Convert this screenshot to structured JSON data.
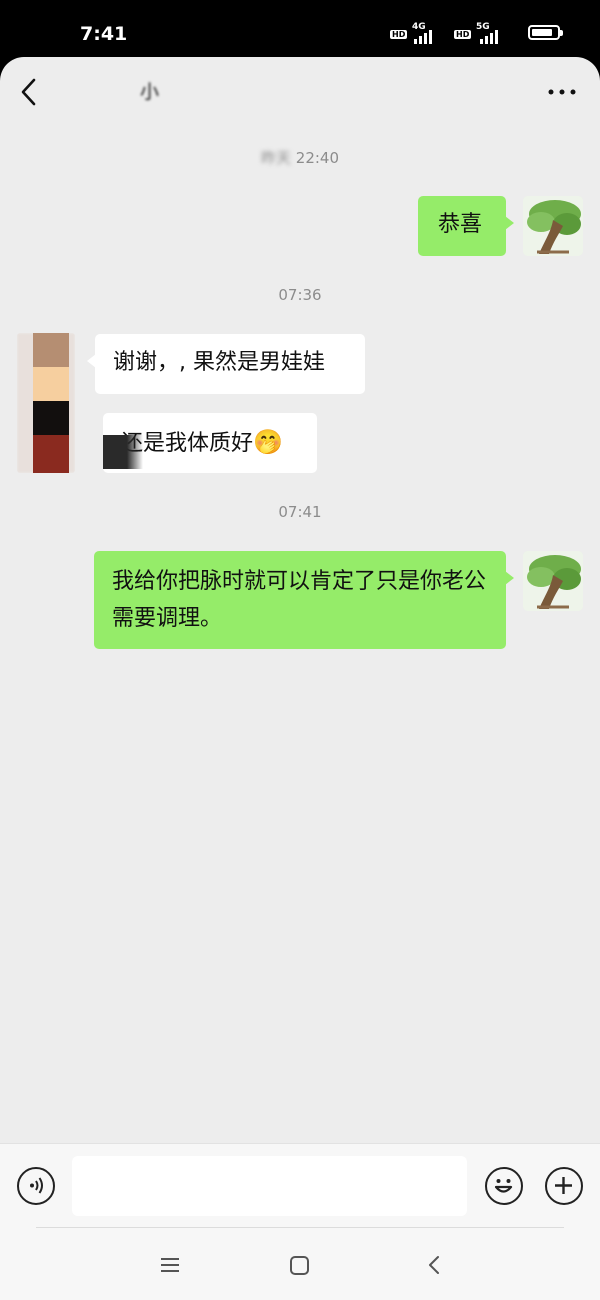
{
  "status_bar": {
    "time": "7:41",
    "network_1": "4G",
    "network_2": "5G",
    "hd_label": "HD",
    "battery_level": 0.85
  },
  "header": {
    "title": "小",
    "back_icon": "chevron-left-icon",
    "more_icon": "more-dots-icon"
  },
  "messages": [
    {
      "type": "time",
      "text_blurred": "昨天",
      "text": "22:40"
    },
    {
      "type": "outgoing",
      "text": "恭喜"
    },
    {
      "type": "time",
      "text": "07:36"
    },
    {
      "type": "incoming",
      "text": "谢谢，, 果然是男娃娃"
    },
    {
      "type": "incoming",
      "text": "还是我体质好",
      "emoji": "🤭"
    },
    {
      "type": "time",
      "text": "07:41"
    },
    {
      "type": "outgoing",
      "text": "我给你把脉时就可以肯定了只是你老公需要调理。"
    }
  ],
  "input_bar": {
    "placeholder": "",
    "voice_icon": "voice-icon",
    "emoji_icon": "smiley-icon",
    "add_icon": "plus-icon"
  },
  "nav_bar": {
    "menu_icon": "menu-icon",
    "home_icon": "home-square-icon",
    "back_icon": "back-triangle-icon"
  },
  "colors": {
    "outgoing_bubble": "#95ec69",
    "incoming_bubble": "#ffffff",
    "chat_background": "#ededed"
  }
}
